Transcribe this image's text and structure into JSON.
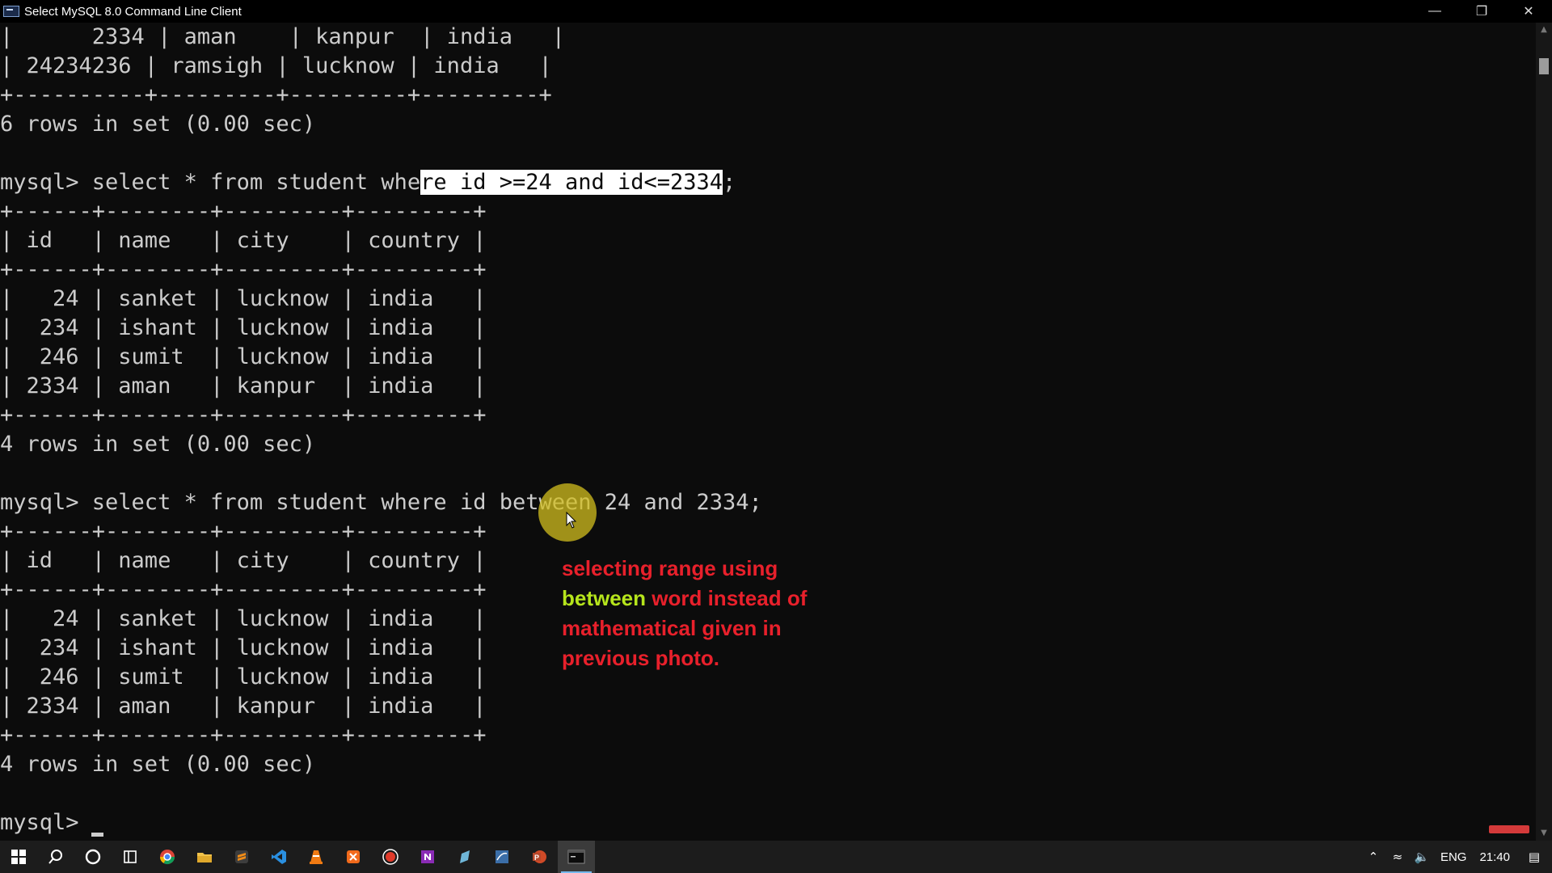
{
  "window": {
    "title": "Select MySQL 8.0 Command Line Client",
    "minimize_glyph": "—",
    "restore_glyph": "❐",
    "close_glyph": "✕"
  },
  "terminal": {
    "lines": [
      "|      2334 | aman    | kanpur  | india   |",
      "| 24234236 | ramsigh | lucknow | india   |",
      "+----------+---------+---------+---------+",
      "6 rows in set (0.00 sec)",
      "",
      "",
      "+------+--------+---------+---------+",
      "| id   | name   | city    | country |",
      "+------+--------+---------+---------+",
      "|   24 | sanket | lucknow | india   |",
      "|  234 | ishant | lucknow | india   |",
      "|  246 | sumit  | lucknow | india   |",
      "| 2334 | aman   | kanpur  | india   |",
      "+------+--------+---------+---------+",
      "4 rows in set (0.00 sec)",
      "",
      "mysql> select * from student where id between 24 and 2334;",
      "+------+--------+---------+---------+",
      "| id   | name   | city    | country |",
      "+------+--------+---------+---------+",
      "|   24 | sanket | lucknow | india   |",
      "|  234 | ishant | lucknow | india   |",
      "|  246 | sumit  | lucknow | india   |",
      "| 2334 | aman   | kanpur  | india   |",
      "+------+--------+---------+---------+",
      "4 rows in set (0.00 sec)",
      "",
      "mysql> "
    ],
    "query1": {
      "before": "mysql> select * from student whe",
      "selected": "re id >=24 and id<=2334",
      "after": ";"
    }
  },
  "annotation": {
    "line1": "selecting range using",
    "keyword": "between",
    "line2_rest": " word instead of",
    "line3": "mathematical given in",
    "line4": "previous photo."
  },
  "taskbar": {
    "apps": [
      {
        "name": "start",
        "icon": "windows-logo-icon"
      },
      {
        "name": "search",
        "icon": "search-icon"
      },
      {
        "name": "cortana",
        "icon": "cortana-circle-icon"
      },
      {
        "name": "task-view",
        "icon": "task-view-icon"
      },
      {
        "name": "chrome",
        "icon": "chrome-icon",
        "color": "#e9b12c"
      },
      {
        "name": "file-explorer",
        "icon": "folder-icon",
        "color": "#f0c24a"
      },
      {
        "name": "sublime",
        "icon": "sublime-icon",
        "color": "#f08c17"
      },
      {
        "name": "vscode",
        "icon": "vscode-icon",
        "color": "#2a8fe0"
      },
      {
        "name": "vlc",
        "icon": "vlc-icon",
        "color": "#f07a12"
      },
      {
        "name": "app-orange",
        "icon": "orange-app-icon",
        "color": "#f26a1b"
      },
      {
        "name": "screen-recorder",
        "icon": "record-icon",
        "color": "#e03a2a"
      },
      {
        "name": "onenote",
        "icon": "onenote-icon",
        "color": "#8a2bb5"
      },
      {
        "name": "notepad",
        "icon": "pen-icon",
        "color": "#6fb6d8"
      },
      {
        "name": "mysql-workbench",
        "icon": "workbench-icon",
        "color": "#3b6ea8"
      },
      {
        "name": "powerpoint",
        "icon": "powerpoint-icon",
        "color": "#d04a27"
      },
      {
        "name": "mysql-cli",
        "icon": "terminal-icon",
        "color": "#2a2a2a",
        "active": true
      }
    ],
    "tray": {
      "language": "ENG",
      "time": "21:40"
    }
  }
}
